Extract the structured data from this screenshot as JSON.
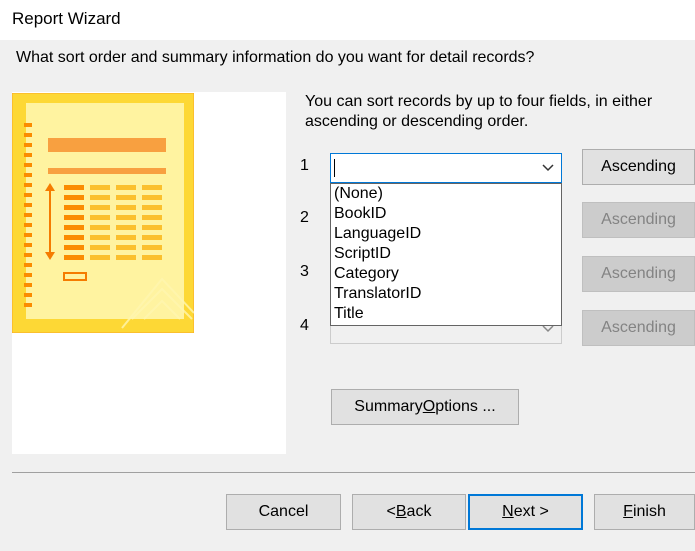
{
  "window": {
    "title": "Report Wizard"
  },
  "prompt": "What sort order and summary information do you want for detail records?",
  "info": "You can sort records by up to four fields, in either ascending or descending order.",
  "sort_fields": [
    {
      "number": "1",
      "value": "",
      "order_label": "Ascending"
    },
    {
      "number": "2",
      "value": "",
      "order_label": "Ascending"
    },
    {
      "number": "3",
      "value": "",
      "order_label": "Ascending"
    },
    {
      "number": "4",
      "value": "",
      "order_label": "Ascending"
    }
  ],
  "dropdown_options": [
    "(None)",
    "BookID",
    "LanguageID",
    "ScriptID",
    "Category",
    "TranslatorID",
    "Title"
  ],
  "summary_button": {
    "before": "Summary ",
    "key": "O",
    "after": "ptions ..."
  },
  "footer": {
    "cancel": "Cancel",
    "back": {
      "before": "< ",
      "key": "B",
      "after": "ack"
    },
    "next": {
      "before": "",
      "key": "N",
      "after": "ext >"
    },
    "finish": {
      "before": "",
      "key": "F",
      "after": "inish"
    }
  },
  "colors": {
    "illustration_bg": "#fdd835",
    "illustration_accent": "#f57c00",
    "focus_border": "#0078d7"
  }
}
